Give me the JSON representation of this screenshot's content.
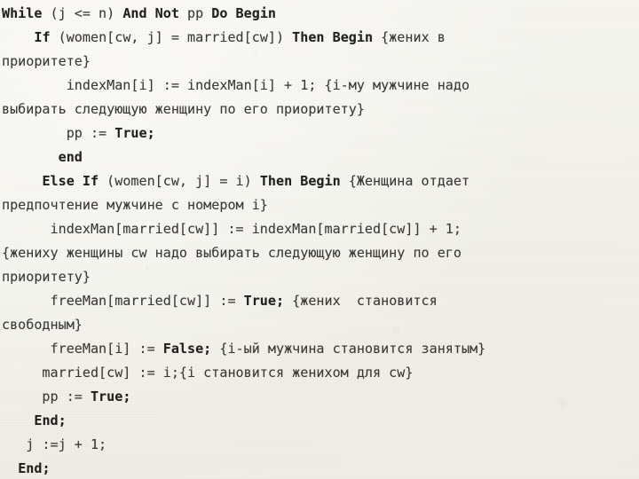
{
  "document": {
    "kind": "pascal-source-listing",
    "language": "Pascal",
    "background_color": "#f3f2ec",
    "text_color": "#33322e",
    "keyword_color": "#211f1c",
    "line_count": 17,
    "lines": [
      {
        "id": "line-01",
        "text": "While (j <= n) And Not pp Do Begin",
        "segments": [
          {
            "t": "While",
            "k": true
          },
          {
            "t": " (j <= n) ",
            "k": false
          },
          {
            "t": "And Not",
            "k": true
          },
          {
            "t": " pp ",
            "k": false
          },
          {
            "t": "Do Begin",
            "k": true
          }
        ]
      },
      {
        "id": "line-02",
        "text": "    If (women[cw, j] = married[cw]) Then Begin {жених в",
        "segments": [
          {
            "t": "    ",
            "k": false
          },
          {
            "t": "If",
            "k": true
          },
          {
            "t": " (women[cw, j] = married[cw]) ",
            "k": false
          },
          {
            "t": "Then Begin",
            "k": true
          },
          {
            "t": " {жених в",
            "k": false
          }
        ]
      },
      {
        "id": "line-03",
        "text": "приоритете}",
        "segments": [
          {
            "t": "приоритете}",
            "k": false
          }
        ]
      },
      {
        "id": "line-04",
        "text": "        indexMan[i] := indexMan[i] + 1; {i-му мужчине надо",
        "segments": [
          {
            "t": "        indexMan[i] := indexMan[i] + 1; {i-му мужчине надо",
            "k": false
          }
        ]
      },
      {
        "id": "line-05",
        "text": "выбирать следующую женщину по его приоритету}",
        "segments": [
          {
            "t": "выбирать следующую женщину по его приоритету}",
            "k": false
          }
        ]
      },
      {
        "id": "line-06",
        "text": "        pp := True;",
        "segments": [
          {
            "t": "        pp := ",
            "k": false
          },
          {
            "t": "True;",
            "k": true
          }
        ]
      },
      {
        "id": "line-07",
        "text": "       end",
        "segments": [
          {
            "t": "       ",
            "k": false
          },
          {
            "t": "end",
            "k": true
          }
        ]
      },
      {
        "id": "line-08",
        "text": "     Else If (women[cw, j] = i) Then Begin {Женщина отдает",
        "segments": [
          {
            "t": "     ",
            "k": false
          },
          {
            "t": "Else If",
            "k": true
          },
          {
            "t": " (women[cw, j] = i) ",
            "k": false
          },
          {
            "t": "Then Begin",
            "k": true
          },
          {
            "t": " {Женщина отдает",
            "k": false
          }
        ]
      },
      {
        "id": "line-09",
        "text": "предпочтение мужчине с номером i}",
        "segments": [
          {
            "t": "предпочтение мужчине с номером i}",
            "k": false
          }
        ]
      },
      {
        "id": "line-10",
        "text": "      indexMan[married[cw]] := indexMan[married[cw]] + 1;",
        "segments": [
          {
            "t": "      indexMan[married[cw]] := indexMan[married[cw]] + 1;",
            "k": false
          }
        ]
      },
      {
        "id": "line-11",
        "text": "{жениху женщины cw надо выбирать следующую женщину по его",
        "segments": [
          {
            "t": "{жениху женщины cw надо выбирать следующую женщину по его",
            "k": false
          }
        ]
      },
      {
        "id": "line-12",
        "text": "приоритету}",
        "segments": [
          {
            "t": "приоритету}",
            "k": false
          }
        ]
      },
      {
        "id": "line-13",
        "text": "      freeMan[married[cw]] := True; {жених  становится",
        "segments": [
          {
            "t": "      freeMan[married[cw]] := ",
            "k": false
          },
          {
            "t": "True;",
            "k": true
          },
          {
            "t": " {жених  становится",
            "k": false
          }
        ]
      },
      {
        "id": "line-14",
        "text": "свободным}",
        "segments": [
          {
            "t": "свободным}",
            "k": false
          }
        ]
      },
      {
        "id": "line-15",
        "text": "      freeMan[i] := False; {i-ый мужчина становится занятым}",
        "segments": [
          {
            "t": "      freeMan[i] := ",
            "k": false
          },
          {
            "t": "False;",
            "k": true
          },
          {
            "t": " {i-ый мужчина становится занятым}",
            "k": false
          }
        ]
      },
      {
        "id": "line-16",
        "text": "     married[cw] := i;{i становится женихом для cw}",
        "segments": [
          {
            "t": "     married[cw] := i;{i становится женихом для cw}",
            "k": false
          }
        ]
      },
      {
        "id": "line-17",
        "text": "     pp := True;",
        "segments": [
          {
            "t": "     pp := ",
            "k": false
          },
          {
            "t": "True;",
            "k": true
          }
        ]
      },
      {
        "id": "line-18",
        "text": "    End;",
        "segments": [
          {
            "t": "    ",
            "k": false
          },
          {
            "t": "End;",
            "k": true
          }
        ]
      },
      {
        "id": "line-19",
        "text": "   j :=j + 1;",
        "segments": [
          {
            "t": "   j :=j + 1;",
            "k": false
          }
        ]
      },
      {
        "id": "line-20",
        "text": "  End;",
        "segments": [
          {
            "t": "  ",
            "k": false
          },
          {
            "t": "End;",
            "k": true
          }
        ]
      }
    ]
  }
}
